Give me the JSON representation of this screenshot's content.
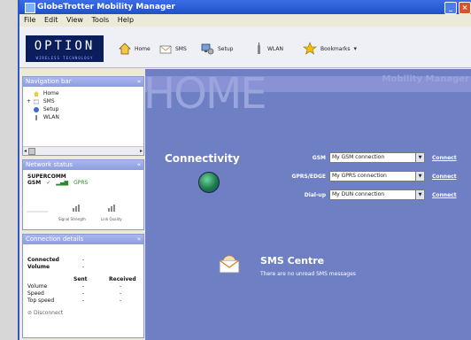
{
  "window": {
    "title": "GlobeTrotter Mobility Manager"
  },
  "menu": [
    "File",
    "Edit",
    "View",
    "Tools",
    "Help"
  ],
  "logo": {
    "text": "OPTION",
    "tagline": "WIRELESS TECHNOLOGY"
  },
  "toolbar": [
    {
      "label": "Home",
      "icon": "home-icon"
    },
    {
      "label": "SMS",
      "icon": "sms-icon"
    },
    {
      "label": "Setup",
      "icon": "setup-icon"
    },
    {
      "label": "WLAN",
      "icon": "wlan-icon"
    },
    {
      "label": "Bookmarks",
      "icon": "star-icon"
    }
  ],
  "nav": {
    "title": "Navigation bar",
    "items": [
      {
        "label": "Home",
        "icon": "home-icon"
      },
      {
        "label": "SMS",
        "icon": "sms-icon"
      },
      {
        "label": "Setup",
        "icon": "setup-icon"
      },
      {
        "label": "WLAN",
        "icon": "wlan-icon"
      }
    ]
  },
  "status": {
    "title": "Network status",
    "operator": "SUPERCOMM",
    "mode": "GSM",
    "service": "GPRS",
    "level_labels": [
      "Signal Strength",
      "Link Quality"
    ]
  },
  "details": {
    "title": "Connection details",
    "connected_label": "Connected",
    "connected_value": "-",
    "volume_label": "Volume",
    "volume_value": "-",
    "sent_label": "Sent",
    "received_label": "Received",
    "rows": [
      {
        "label": "Volume",
        "sent": "-",
        "received": "-"
      },
      {
        "label": "Speed",
        "sent": "-",
        "received": "-"
      },
      {
        "label": "Top speed",
        "sent": "-",
        "received": "-"
      }
    ],
    "disconnect_label": "Disconnect"
  },
  "main": {
    "home_title": "HOME",
    "watermark": "Mobility Manager",
    "connectivity": {
      "heading": "Connectivity",
      "rows": [
        {
          "label": "GSM",
          "value": "My GSM connection",
          "action": "Connect"
        },
        {
          "label": "GPRS/EDGE",
          "value": "My GPRS connection",
          "action": "Connect"
        },
        {
          "label": "Dial-up",
          "value": "My DUN connection",
          "action": "Connect"
        }
      ]
    },
    "sms": {
      "heading": "SMS Centre",
      "message": "There are no unread SMS messages"
    }
  }
}
